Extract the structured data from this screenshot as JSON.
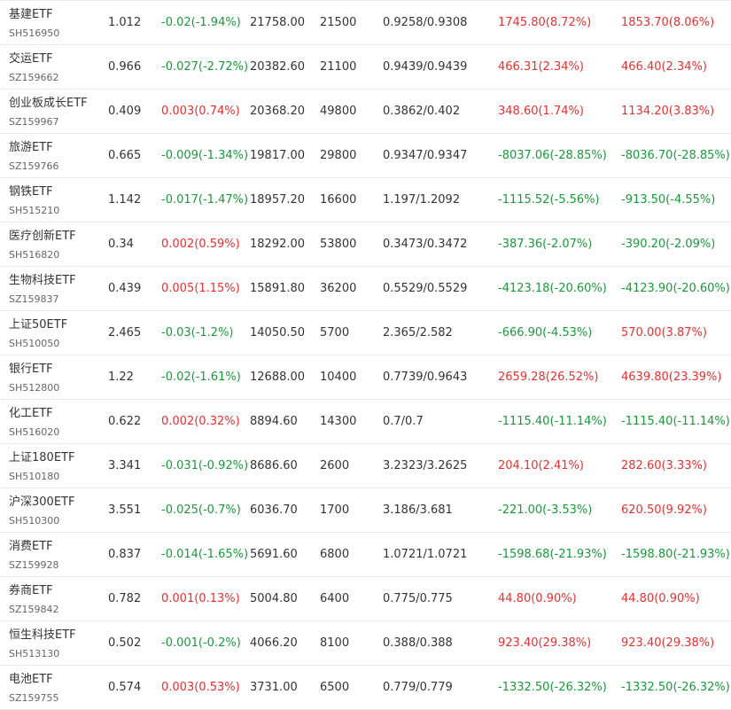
{
  "colors": {
    "up": "#e93030",
    "down": "#1a9a3a",
    "text": "#333333",
    "code": "#666666",
    "border": "#e8e8e8"
  },
  "rows": [
    {
      "name": "基建ETF",
      "code": "SH516950",
      "price": "1.012",
      "change": "-0.02(-1.94%)",
      "change_dir": "down",
      "amount": "21758.00",
      "volume": "21500",
      "range": "0.9258/0.9308",
      "flow1": "1745.80(8.72%)",
      "flow1_dir": "up",
      "flow2": "1853.70(8.06%)",
      "flow2_dir": "up"
    },
    {
      "name": "交运ETF",
      "code": "SZ159662",
      "price": "0.966",
      "change": "-0.027(-2.72%)",
      "change_dir": "down",
      "amount": "20382.60",
      "volume": "21100",
      "range": "0.9439/0.9439",
      "flow1": "466.31(2.34%)",
      "flow1_dir": "up",
      "flow2": "466.40(2.34%)",
      "flow2_dir": "up"
    },
    {
      "name": "创业板成长ETF",
      "code": "SZ159967",
      "price": "0.409",
      "change": "0.003(0.74%)",
      "change_dir": "up",
      "amount": "20368.20",
      "volume": "49800",
      "range": "0.3862/0.402",
      "flow1": "348.60(1.74%)",
      "flow1_dir": "up",
      "flow2": "1134.20(3.83%)",
      "flow2_dir": "up"
    },
    {
      "name": "旅游ETF",
      "code": "SZ159766",
      "price": "0.665",
      "change": "-0.009(-1.34%)",
      "change_dir": "down",
      "amount": "19817.00",
      "volume": "29800",
      "range": "0.9347/0.9347",
      "flow1": "-8037.06(-28.85%)",
      "flow1_dir": "down",
      "flow2": "-8036.70(-28.85%)",
      "flow2_dir": "down"
    },
    {
      "name": "钢铁ETF",
      "code": "SH515210",
      "price": "1.142",
      "change": "-0.017(-1.47%)",
      "change_dir": "down",
      "amount": "18957.20",
      "volume": "16600",
      "range": "1.197/1.2092",
      "flow1": "-1115.52(-5.56%)",
      "flow1_dir": "down",
      "flow2": "-913.50(-4.55%)",
      "flow2_dir": "down"
    },
    {
      "name": "医疗创新ETF",
      "code": "SH516820",
      "price": "0.34",
      "change": "0.002(0.59%)",
      "change_dir": "up",
      "amount": "18292.00",
      "volume": "53800",
      "range": "0.3473/0.3472",
      "flow1": "-387.36(-2.07%)",
      "flow1_dir": "down",
      "flow2": "-390.20(-2.09%)",
      "flow2_dir": "down"
    },
    {
      "name": "生物科技ETF",
      "code": "SZ159837",
      "price": "0.439",
      "change": "0.005(1.15%)",
      "change_dir": "up",
      "amount": "15891.80",
      "volume": "36200",
      "range": "0.5529/0.5529",
      "flow1": "-4123.18(-20.60%)",
      "flow1_dir": "down",
      "flow2": "-4123.90(-20.60%)",
      "flow2_dir": "down"
    },
    {
      "name": "上证50ETF",
      "code": "SH510050",
      "price": "2.465",
      "change": "-0.03(-1.2%)",
      "change_dir": "down",
      "amount": "14050.50",
      "volume": "5700",
      "range": "2.365/2.582",
      "flow1": "-666.90(-4.53%)",
      "flow1_dir": "down",
      "flow2": "570.00(3.87%)",
      "flow2_dir": "up"
    },
    {
      "name": "银行ETF",
      "code": "SH512800",
      "price": "1.22",
      "change": "-0.02(-1.61%)",
      "change_dir": "down",
      "amount": "12688.00",
      "volume": "10400",
      "range": "0.7739/0.9643",
      "flow1": "2659.28(26.52%)",
      "flow1_dir": "up",
      "flow2": "4639.80(23.39%)",
      "flow2_dir": "up"
    },
    {
      "name": "化工ETF",
      "code": "SH516020",
      "price": "0.622",
      "change": "0.002(0.32%)",
      "change_dir": "up",
      "amount": "8894.60",
      "volume": "14300",
      "range": "0.7/0.7",
      "flow1": "-1115.40(-11.14%)",
      "flow1_dir": "down",
      "flow2": "-1115.40(-11.14%)",
      "flow2_dir": "down"
    },
    {
      "name": "上证180ETF",
      "code": "SH510180",
      "price": "3.341",
      "change": "-0.031(-0.92%)",
      "change_dir": "down",
      "amount": "8686.60",
      "volume": "2600",
      "range": "3.2323/3.2625",
      "flow1": "204.10(2.41%)",
      "flow1_dir": "up",
      "flow2": "282.60(3.33%)",
      "flow2_dir": "up"
    },
    {
      "name": "沪深300ETF",
      "code": "SH510300",
      "price": "3.551",
      "change": "-0.025(-0.7%)",
      "change_dir": "down",
      "amount": "6036.70",
      "volume": "1700",
      "range": "3.186/3.681",
      "flow1": "-221.00(-3.53%)",
      "flow1_dir": "down",
      "flow2": "620.50(9.92%)",
      "flow2_dir": "up"
    },
    {
      "name": "消费ETF",
      "code": "SZ159928",
      "price": "0.837",
      "change": "-0.014(-1.65%)",
      "change_dir": "down",
      "amount": "5691.60",
      "volume": "6800",
      "range": "1.0721/1.0721",
      "flow1": "-1598.68(-21.93%)",
      "flow1_dir": "down",
      "flow2": "-1598.80(-21.93%)",
      "flow2_dir": "down"
    },
    {
      "name": "券商ETF",
      "code": "SZ159842",
      "price": "0.782",
      "change": "0.001(0.13%)",
      "change_dir": "up",
      "amount": "5004.80",
      "volume": "6400",
      "range": "0.775/0.775",
      "flow1": "44.80(0.90%)",
      "flow1_dir": "up",
      "flow2": "44.80(0.90%)",
      "flow2_dir": "up"
    },
    {
      "name": "恒生科技ETF",
      "code": "SH513130",
      "price": "0.502",
      "change": "-0.001(-0.2%)",
      "change_dir": "down",
      "amount": "4066.20",
      "volume": "8100",
      "range": "0.388/0.388",
      "flow1": "923.40(29.38%)",
      "flow1_dir": "up",
      "flow2": "923.40(29.38%)",
      "flow2_dir": "up"
    },
    {
      "name": "电池ETF",
      "code": "SZ159755",
      "price": "0.574",
      "change": "0.003(0.53%)",
      "change_dir": "up",
      "amount": "3731.00",
      "volume": "6500",
      "range": "0.779/0.779",
      "flow1": "-1332.50(-26.32%)",
      "flow1_dir": "down",
      "flow2": "-1332.50(-26.32%)",
      "flow2_dir": "down"
    }
  ]
}
